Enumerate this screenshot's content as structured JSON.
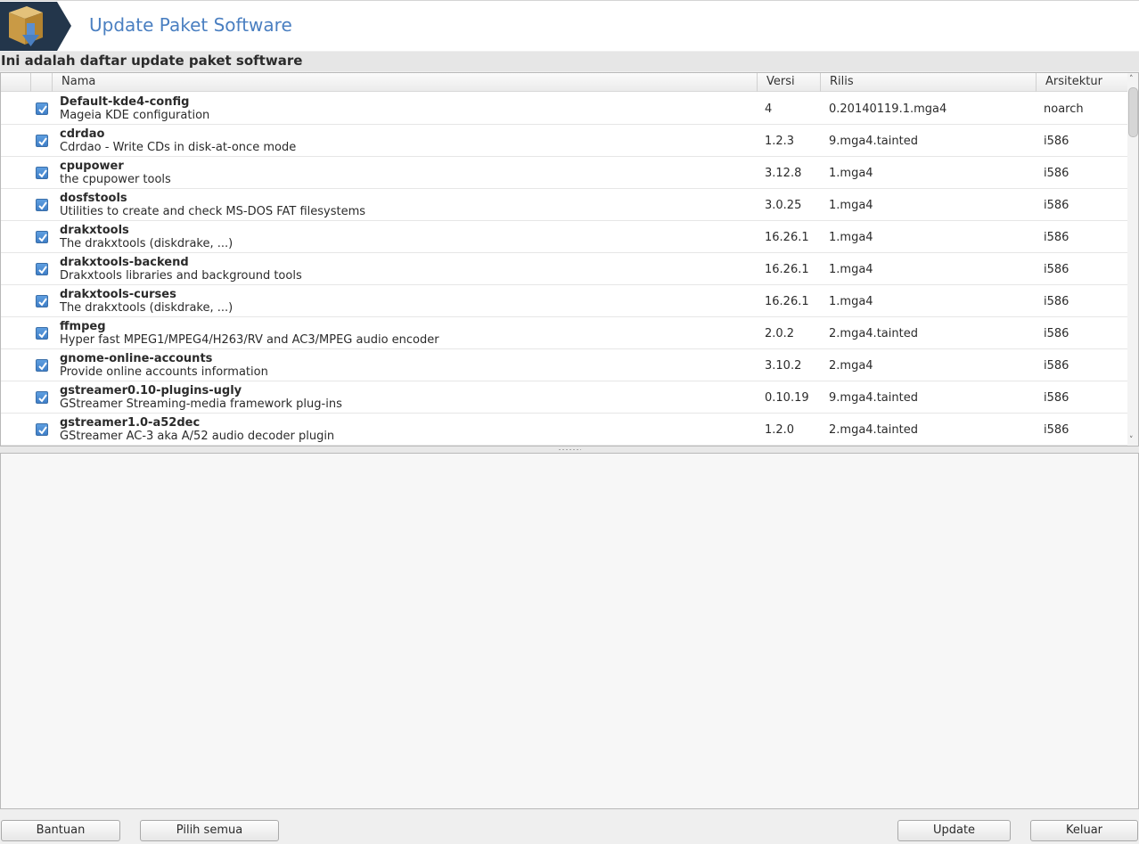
{
  "header": {
    "title": "Update Paket Software",
    "logo_icon": "package-download-icon"
  },
  "subtitle": "Ini adalah daftar update paket software",
  "table": {
    "columns": [
      "",
      "Nama",
      "Versi",
      "Rilis",
      "Arsitektur"
    ],
    "rows": [
      {
        "name": "Default-kde4-config",
        "desc": "Mageia KDE configuration",
        "version": "4",
        "release": "0.20140119.1.mga4",
        "arch": "noarch",
        "checked": true
      },
      {
        "name": "cdrdao",
        "desc": "Cdrdao - Write CDs in disk-at-once mode",
        "version": "1.2.3",
        "release": "9.mga4.tainted",
        "arch": "i586",
        "checked": true
      },
      {
        "name": "cpupower",
        "desc": "the cpupower tools",
        "version": "3.12.8",
        "release": "1.mga4",
        "arch": "i586",
        "checked": true
      },
      {
        "name": "dosfstools",
        "desc": "Utilities to create and check MS-DOS FAT filesystems",
        "version": "3.0.25",
        "release": "1.mga4",
        "arch": "i586",
        "checked": true
      },
      {
        "name": "drakxtools",
        "desc": "The drakxtools (diskdrake, ...)",
        "version": "16.26.1",
        "release": "1.mga4",
        "arch": "i586",
        "checked": true
      },
      {
        "name": "drakxtools-backend",
        "desc": "Drakxtools libraries and background tools",
        "version": "16.26.1",
        "release": "1.mga4",
        "arch": "i586",
        "checked": true
      },
      {
        "name": "drakxtools-curses",
        "desc": "The drakxtools (diskdrake, ...)",
        "version": "16.26.1",
        "release": "1.mga4",
        "arch": "i586",
        "checked": true
      },
      {
        "name": "ffmpeg",
        "desc": "Hyper fast MPEG1/MPEG4/H263/RV and AC3/MPEG audio encoder",
        "version": "2.0.2",
        "release": "2.mga4.tainted",
        "arch": "i586",
        "checked": true
      },
      {
        "name": "gnome-online-accounts",
        "desc": "Provide online accounts information",
        "version": "3.10.2",
        "release": "2.mga4",
        "arch": "i586",
        "checked": true
      },
      {
        "name": "gstreamer0.10-plugins-ugly",
        "desc": "GStreamer Streaming-media framework plug-ins",
        "version": "0.10.19",
        "release": "9.mga4.tainted",
        "arch": "i586",
        "checked": true
      },
      {
        "name": "gstreamer1.0-a52dec",
        "desc": "GStreamer AC-3 aka A/52 audio decoder plugin",
        "version": "1.2.0",
        "release": "2.mga4.tainted",
        "arch": "i586",
        "checked": true
      }
    ]
  },
  "buttons": {
    "help": "Bantuan",
    "select_all": "Pilih semua",
    "update": "Update",
    "quit": "Keluar"
  },
  "scrollbar": {
    "up_glyph": "˄",
    "down_glyph": "˅"
  },
  "colors": {
    "accent": "#4a7fc1",
    "logo_bg": "#23364b"
  }
}
